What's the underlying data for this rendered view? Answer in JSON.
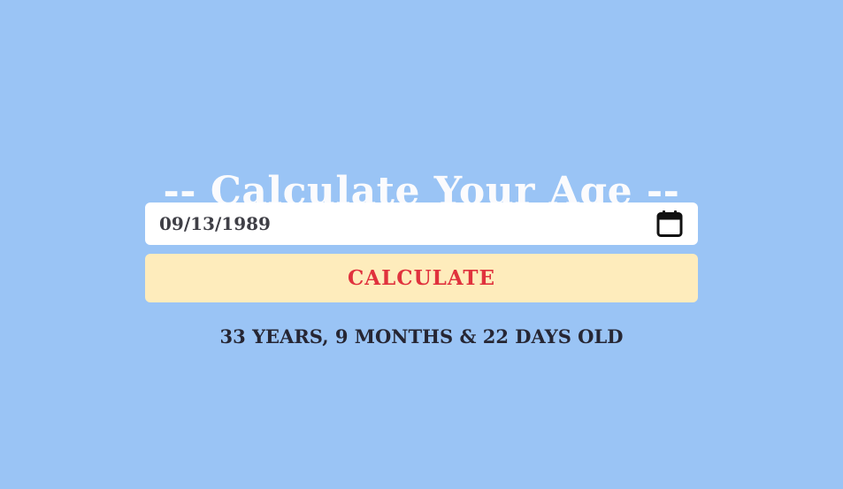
{
  "page": {
    "title": "-- Calculate Your Age --"
  },
  "date_input": {
    "value": "09/13/1989",
    "icon": "calendar-icon"
  },
  "calculate_button": {
    "label": "CALCULATE"
  },
  "result": {
    "text": "33 YEARS, 9 MONTHS & 22 DAYS OLD"
  },
  "colors": {
    "background": "#9ac4f5",
    "title": "#fbfbfd",
    "input_background": "#ffffff",
    "button_background": "#feecbc",
    "button_text": "#e0323d",
    "result_text": "#262633"
  }
}
